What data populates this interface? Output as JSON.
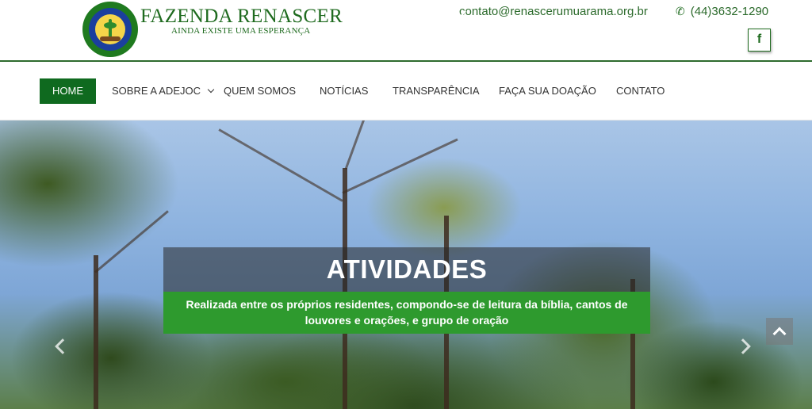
{
  "header": {
    "brand_title": "FAZENDA RENASCER",
    "brand_subtitle": "AINDA EXISTE UMA ESPERANÇA",
    "email": "contato@renascerumuarama.org.br",
    "phone": "(44)3632-1290",
    "social": {
      "facebook_label": "f"
    }
  },
  "nav": {
    "items": [
      {
        "label": "HOME",
        "active": true
      },
      {
        "label": "SOBRE A ADEJOC",
        "has_dropdown": true
      },
      {
        "label": "QUEM SOMOS"
      },
      {
        "label": "NOTÍCIAS"
      },
      {
        "label": "TRANSPARÊNCIA"
      },
      {
        "label": "FAÇA SUA DOAÇÃO"
      },
      {
        "label": "CONTATO"
      }
    ]
  },
  "hero": {
    "title": "ATIVIDADES",
    "text": "Realizada entre os próprios residentes, compondo-se de leitura da bíblia, cantos de louvores e orações, e grupo de oração"
  },
  "icons": {
    "email": "envelope-icon",
    "phone": "phone-icon",
    "facebook": "facebook-icon",
    "prev": "chevron-left-icon",
    "next": "chevron-right-icon",
    "scroll_top": "chevron-up-icon"
  },
  "colors": {
    "brand_green": "#1f6b1f",
    "nav_active": "#0f6a1f",
    "caption_green": "#2e9a2e"
  }
}
